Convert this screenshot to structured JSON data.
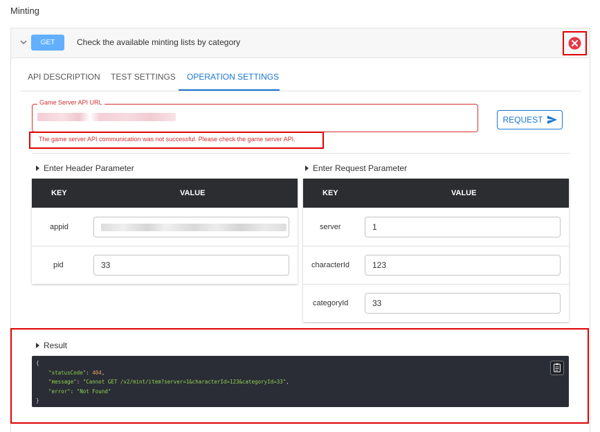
{
  "section": {
    "title": "Minting"
  },
  "endpoint": {
    "method": "GET",
    "title": "Check the available minting lists by category"
  },
  "tabs": [
    {
      "label": "API DESCRIPTION"
    },
    {
      "label": "TEST SETTINGS"
    },
    {
      "label": "OPERATION SETTINGS"
    }
  ],
  "url_field": {
    "label": "Game Server API URL",
    "error": "The game server API communication was not successful. Please check the game server API."
  },
  "request_button": {
    "label": "REQUEST",
    "icon": "send-icon"
  },
  "header_params": {
    "heading": "Enter Header Parameter",
    "columns": [
      "KEY",
      "VALUE"
    ],
    "rows": [
      {
        "key": "appid",
        "value": ""
      },
      {
        "key": "pid",
        "value": "33"
      }
    ]
  },
  "request_params": {
    "heading": "Enter Request Parameter",
    "columns": [
      "KEY",
      "VALUE"
    ],
    "rows": [
      {
        "key": "server",
        "value": "1"
      },
      {
        "key": "characterId",
        "value": "123"
      },
      {
        "key": "categoryId",
        "value": "33"
      }
    ]
  },
  "result": {
    "heading": "Result",
    "open_brace": "{",
    "close_brace": "}",
    "status_key": "\"statusCode\"",
    "status_value": "404",
    "message_key": "\"message\"",
    "message_value": "\"Cannot GET /v2/mint/item?server=1&characterId=123&categoryId=33\"",
    "error_key": "\"error\"",
    "error_value": "\"Not Found\"",
    "copy_icon": "clipboard-icon"
  },
  "colors": {
    "accent": "#1976d2",
    "method": "#61affe",
    "error": "#d32f2f",
    "highlight": "#e00000",
    "table_header": "#2b2d30"
  }
}
